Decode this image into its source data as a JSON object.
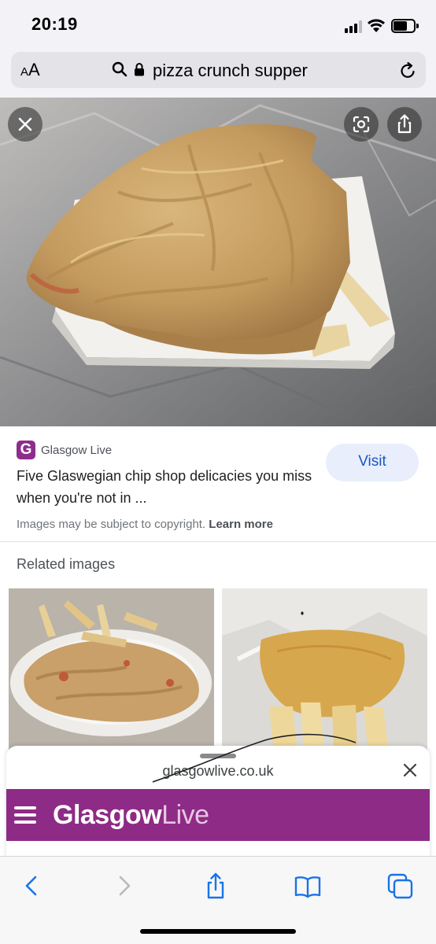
{
  "status_bar": {
    "time": "20:19",
    "signal_bars": 4,
    "signal_bars_filled": 3,
    "icons": [
      "cellular-signal-icon",
      "wifi-icon",
      "battery-icon"
    ]
  },
  "address_bar": {
    "text_size_label": "AA",
    "url_text": "pizza crunch supper",
    "icons": [
      "search-icon",
      "lock-icon",
      "reload-icon"
    ]
  },
  "image_viewer": {
    "image_alt": "Battered fried pizza crunch on a white polystyrene tray",
    "buttons": [
      "close-icon",
      "lens-icon",
      "share-icon"
    ]
  },
  "result": {
    "source_logo_letter": "G",
    "source_name": "Glasgow Live",
    "title": "Five Glaswegian chip shop delicacies you miss when you're not in ...",
    "visit_label": "Visit",
    "copyright_text": "Images may be subject to copyright.",
    "learn_more_label": "Learn more"
  },
  "related": {
    "heading": "Related images",
    "thumbnails": [
      {
        "alt": "Fried pizza crunch with chips on a plate"
      },
      {
        "alt": "Battered pizza with chips in a paper wrapper"
      }
    ]
  },
  "preview_sheet": {
    "domain": "glasgowlive.co.uk",
    "brand_part1": "Glasgow",
    "brand_part2": "Live"
  },
  "toolbar": {
    "buttons": [
      "back-icon",
      "forward-icon",
      "share-icon",
      "bookmarks-icon",
      "tabs-icon"
    ]
  },
  "colors": {
    "brand_purple": "#8e2b86",
    "visit_bg": "#e8eefb",
    "ios_blue": "#1a73e8"
  }
}
